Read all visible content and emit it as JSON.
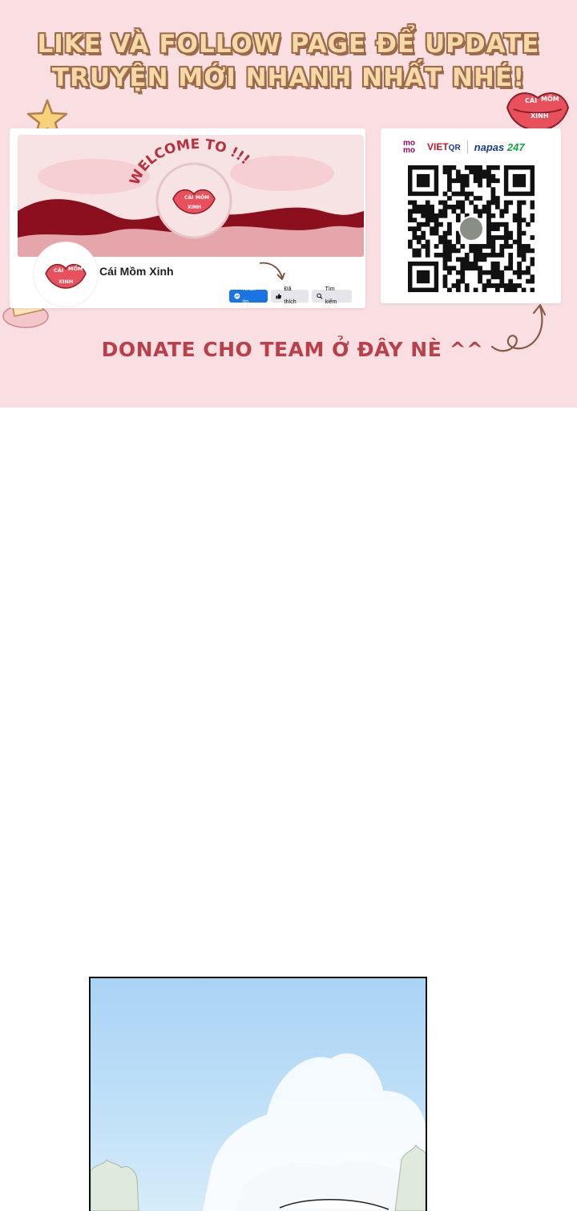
{
  "banner": {
    "headline_line1": "LIKE VÀ FOLLOW PAGE ĐỂ UPDATE",
    "headline_line2": "TRUYỆN MỚI NHANH NHẤT NHÉ!",
    "sticker_line1": "CÁI",
    "sticker_line2": "MỒM",
    "sticker_line3": "XINH",
    "donate_text": "DONATE CHO TEAM Ở ĐÂY NÈ ^^",
    "colors": {
      "background": "#f9dfe1",
      "headline": "#f6d9a6",
      "headline_outline": "#9b6b4b",
      "donate": "#b9404a"
    }
  },
  "facebook_card": {
    "cover_text": "WELCOME TO !!!",
    "avatar_line1": "CÁI",
    "avatar_line2": "MỒM",
    "avatar_line3": "XINH",
    "page_name": "Cái Mồm Xinh",
    "buttons": {
      "message": "Nhắn tin",
      "liked": "Đã thích",
      "search": "Tìm kiếm"
    }
  },
  "qr_card": {
    "logos": {
      "momo_top": "mo",
      "momo_bottom": "mo",
      "vietqr_a": "VIET",
      "vietqr_b": "QR",
      "napas_a": "napas",
      "napas_b": "247"
    }
  },
  "icons": [
    "star-icon",
    "lips-icon",
    "cake-icon",
    "curved-arrow-icon",
    "swirl-arrow-icon",
    "messenger-icon",
    "thumbs-up-icon",
    "search-icon",
    "qr-code"
  ]
}
